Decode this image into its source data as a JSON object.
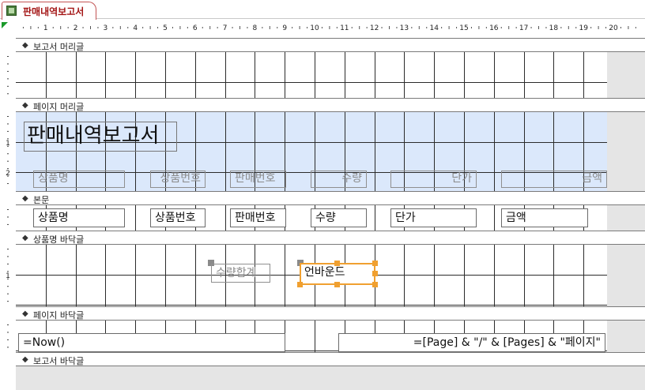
{
  "tab": {
    "title": "판매내역보고서"
  },
  "ruler": {
    "numbers": [
      "1",
      "2",
      "3",
      "4",
      "5",
      "6",
      "7",
      "8",
      "9",
      "10",
      "11",
      "12",
      "13",
      "14",
      "15",
      "16",
      "17",
      "18",
      "19",
      "20"
    ]
  },
  "sections": {
    "report_header": "보고서 머리글",
    "page_header": "페이지 머리글",
    "detail": "본문",
    "group_footer": "상품명 바닥글",
    "page_footer": "페이지 바닥글",
    "report_footer": "보고서 바닥글"
  },
  "page_header": {
    "title": "판매내역보고서",
    "labels": {
      "product_name": "상품명",
      "product_no": "상품번호",
      "sale_no": "판매번호",
      "quantity": "수량",
      "unit_price": "단가",
      "amount": "금액"
    }
  },
  "detail": {
    "fields": {
      "product_name": "상품명",
      "product_no": "상품번호",
      "sale_no": "판매번호",
      "quantity": "수량",
      "unit_price": "단가",
      "amount": "금액"
    }
  },
  "group_footer": {
    "sum_label": "수량합계",
    "unbound": "언바운드"
  },
  "page_footer": {
    "now": "=Now()",
    "pages": "=[Page] & \"/\" & [Pages] & \"페이지\""
  },
  "colors": {
    "tab_text": "#a31515",
    "selection": "#f0a030",
    "header_band": "#dbe8fb",
    "gray_area": "#e5e5e5"
  }
}
